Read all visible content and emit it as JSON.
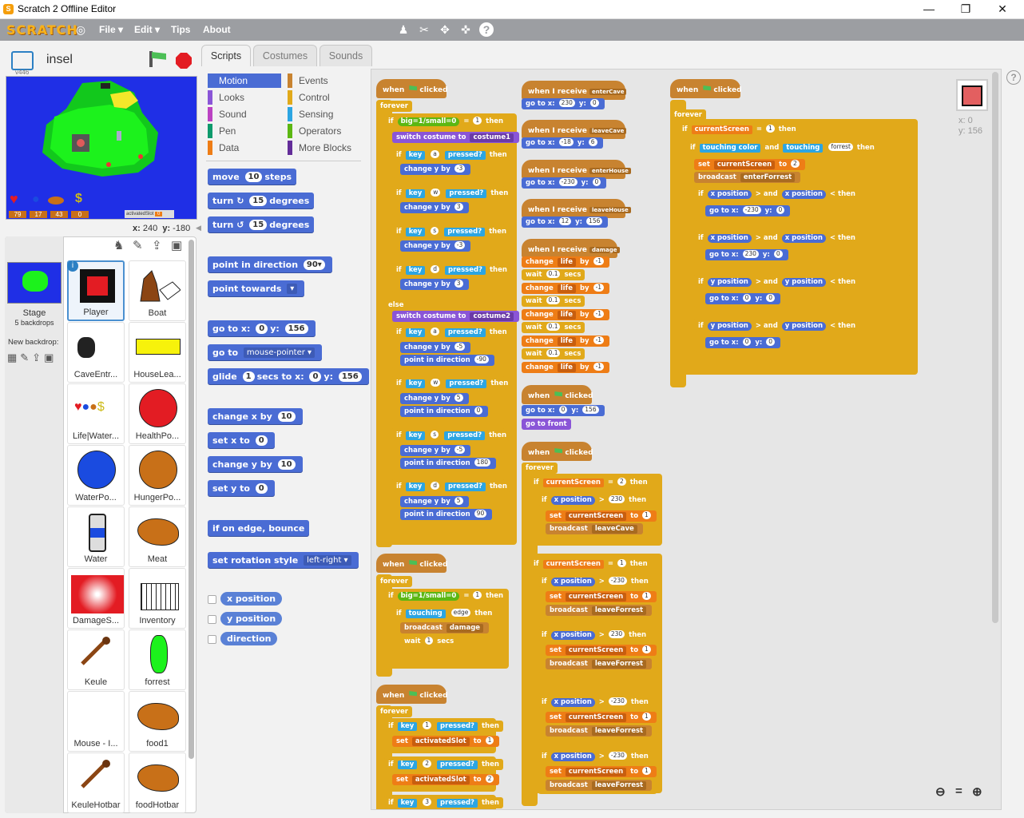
{
  "window": {
    "title": "Scratch 2 Offline Editor",
    "min": "—",
    "max": "❐",
    "close": "✕"
  },
  "menubar": {
    "logo": "SCRATCH",
    "file": "File ▾",
    "edit": "Edit ▾",
    "tips": "Tips",
    "about": "About"
  },
  "stage": {
    "project_name": "insel",
    "version": "v446",
    "x_label": "x:",
    "x": "240",
    "y_label": "y:",
    "y": "-180",
    "hud": [
      "79",
      "17",
      "43",
      "0"
    ],
    "slot_label": "activatedSlot",
    "slot_value": "0",
    "sprite_x_label": "x:",
    "sprite_x": "0",
    "sprite_y_label": "y:",
    "sprite_y": "156"
  },
  "tabs": [
    "Scripts",
    "Costumes",
    "Sounds"
  ],
  "categories": [
    {
      "label": "Motion",
      "color": "#4a6cd4"
    },
    {
      "label": "Events",
      "color": "#c88330"
    },
    {
      "label": "Looks",
      "color": "#8a55d7"
    },
    {
      "label": "Control",
      "color": "#e1a91a"
    },
    {
      "label": "Sound",
      "color": "#bb42c3"
    },
    {
      "label": "Sensing",
      "color": "#2ca5e2"
    },
    {
      "label": "Pen",
      "color": "#0e9a6c"
    },
    {
      "label": "Operators",
      "color": "#5cb712"
    },
    {
      "label": "Data",
      "color": "#ee7d16"
    },
    {
      "label": "More Blocks",
      "color": "#632d99"
    }
  ],
  "palette": {
    "move": [
      "move",
      "10",
      "steps"
    ],
    "turn_r": [
      "turn",
      "↻",
      "15",
      "degrees"
    ],
    "turn_l": [
      "turn",
      "↺",
      "15",
      "degrees"
    ],
    "point_dir": [
      "point in direction",
      "90▾"
    ],
    "point_towards": [
      "point towards",
      "▾"
    ],
    "goto_xy": [
      "go to x:",
      "0",
      "y:",
      "156"
    ],
    "goto": [
      "go to",
      "mouse-pointer ▾"
    ],
    "glide": [
      "glide",
      "1",
      "secs to x:",
      "0",
      "y:",
      "156"
    ],
    "change_x": [
      "change x by",
      "10"
    ],
    "set_x": [
      "set x to",
      "0"
    ],
    "change_y": [
      "change y by",
      "10"
    ],
    "set_y": [
      "set y to",
      "0"
    ],
    "bounce": "if on edge, bounce",
    "rot_style": [
      "set rotation style",
      "left-right ▾"
    ],
    "reporters": [
      "x position",
      "y position",
      "direction"
    ]
  },
  "stage_tile": {
    "label": "Stage",
    "sub": "5 backdrops",
    "new_backdrop": "New backdrop:"
  },
  "sprites": [
    "Player",
    "Boat",
    "CaveEntr...",
    "HouseLea...",
    "Life|Water...",
    "HealthPo...",
    "WaterPo...",
    "HungerPo...",
    "Water",
    "Meat",
    "DamageS...",
    "Inventory",
    "Keule",
    "forrest",
    "Mouse - I...",
    "food1",
    "KeuleHotbar",
    "foodHotbar"
  ],
  "scripts": {
    "when": "when",
    "clicked": "clicked",
    "forever": "forever",
    "if": "if",
    "then": "then",
    "else": "else",
    "cond_big": "big=1/small=0",
    "eq": "=",
    "one": "1",
    "switch_costume": "switch costume to",
    "costume1": "costume1",
    "costume2": "costume2",
    "key": "key",
    "pressed": "pressed?",
    "keys": [
      "a",
      "w",
      "s",
      "d",
      "1",
      "2",
      "3"
    ],
    "change_y_by": "change y by",
    "change_x_by": "change x by",
    "point_in_direction": "point in direction",
    "vals": [
      "-3",
      "3",
      "-3",
      "3",
      "-5",
      "5",
      "-5",
      "5"
    ],
    "dirs": [
      "-90",
      "0",
      "180",
      "90"
    ],
    "touching": "touching",
    "edge": "edge",
    "broadcast": "broadcast",
    "damage": "damage",
    "wait": "wait",
    "secs": "secs",
    "set": "set",
    "to": "to",
    "activatedSlot": "activatedSlot",
    "when_receive": "when I receive",
    "goto_x": "go to x:",
    "y": "y:",
    "receives": [
      "enterCave",
      "leaveCave",
      "enterHouse",
      "leaveHouse",
      "damage"
    ],
    "gotos": [
      [
        "230",
        "0"
      ],
      [
        "-18",
        "6"
      ],
      [
        "-230",
        "0"
      ],
      [
        "12",
        "156"
      ]
    ],
    "change": "change",
    "life": "life",
    "by": "by",
    "minus1": "-1",
    "wait01": "0.1",
    "go_to_front": "go to front",
    "goto156": [
      "0",
      "156"
    ],
    "currentScreen": "currentScreen",
    "xpos": "x position",
    "ypos": "y position",
    "gt": ">",
    "lt": "<",
    "and": "and",
    "leaveCave": "leaveCave",
    "leaveForrest": "leaveForrest",
    "enterForrest": "enterForrest",
    "touching_color": "touching color",
    "forrest": "forrest"
  }
}
